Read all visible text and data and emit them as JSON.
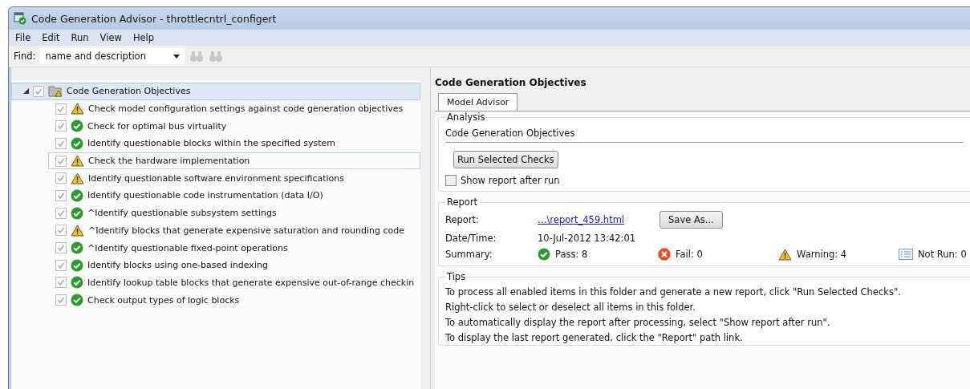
{
  "window": {
    "title": "Code Generation Advisor - throttlecntrl_configert"
  },
  "menu": [
    "File",
    "Edit",
    "Run",
    "View",
    "Help"
  ],
  "find": {
    "label": "Find:",
    "value": "name and description"
  },
  "tree": {
    "label": "Code Generation Objectives",
    "expanded": true,
    "selected": true,
    "checked": true,
    "children": [
      {
        "label": "Check model configuration settings against code generation objectives",
        "kind": "warning",
        "checked": true,
        "focused": false
      },
      {
        "label": "Check for optimal bus virtuality",
        "kind": "pass",
        "checked": true,
        "focused": false
      },
      {
        "label": "Identify questionable blocks within the specified system",
        "kind": "pass",
        "checked": true,
        "focused": false
      },
      {
        "label": "Check the hardware implementation",
        "kind": "warning",
        "checked": true,
        "focused": true
      },
      {
        "label": "Identify questionable software environment specifications",
        "kind": "warning",
        "checked": true,
        "focused": false
      },
      {
        "label": "Identify questionable code instrumentation (data I/O)",
        "kind": "pass",
        "checked": true,
        "focused": false
      },
      {
        "label": "^Identify questionable subsystem settings",
        "kind": "pass",
        "checked": true,
        "focused": false
      },
      {
        "label": "^Identify blocks that generate expensive saturation and rounding code",
        "kind": "warning",
        "checked": true,
        "focused": false
      },
      {
        "label": "^Identify questionable fixed-point operations",
        "kind": "pass",
        "checked": true,
        "focused": false
      },
      {
        "label": "Identify blocks using one-based indexing",
        "kind": "pass",
        "checked": true,
        "focused": false
      },
      {
        "label": "Identify lookup table blocks that generate expensive out-of-range checkin",
        "kind": "pass",
        "checked": true,
        "focused": false
      },
      {
        "label": "Check output types of logic blocks",
        "kind": "pass",
        "checked": true,
        "focused": false
      }
    ]
  },
  "detail": {
    "heading": "Code Generation Objectives",
    "tabs": [
      {
        "label": "Model Advisor",
        "selected": true
      }
    ],
    "analysis": {
      "title": "Analysis",
      "name": "Code Generation Objectives",
      "run_button": "Run Selected Checks",
      "show_report": {
        "label": "Show report after run",
        "checked": false
      }
    },
    "report": {
      "title": "Report",
      "report_label": "Report:",
      "report_link": "…\\report_459.html",
      "save_button": "Save As...",
      "date_label": "Date/Time:",
      "date": "10-Jul-2012 13:42:01",
      "summary_label": "Summary:",
      "summary": [
        {
          "kind": "pass",
          "text": "Pass: 8"
        },
        {
          "kind": "fail",
          "text": "Fail: 0"
        },
        {
          "kind": "warning",
          "text": "Warning: 4"
        },
        {
          "kind": "notrun",
          "text": "Not Run: 0"
        }
      ]
    },
    "tips": {
      "title": "Tips",
      "lines": [
        "To process all enabled items in this folder and generate a new report, click \"Run Selected Checks\".",
        "Right-click to select or deselect all items in this folder.",
        "To automatically display the report after processing, select \"Show report after run\".",
        "To display the last report generated, click the \"Report\" path link."
      ]
    }
  }
}
